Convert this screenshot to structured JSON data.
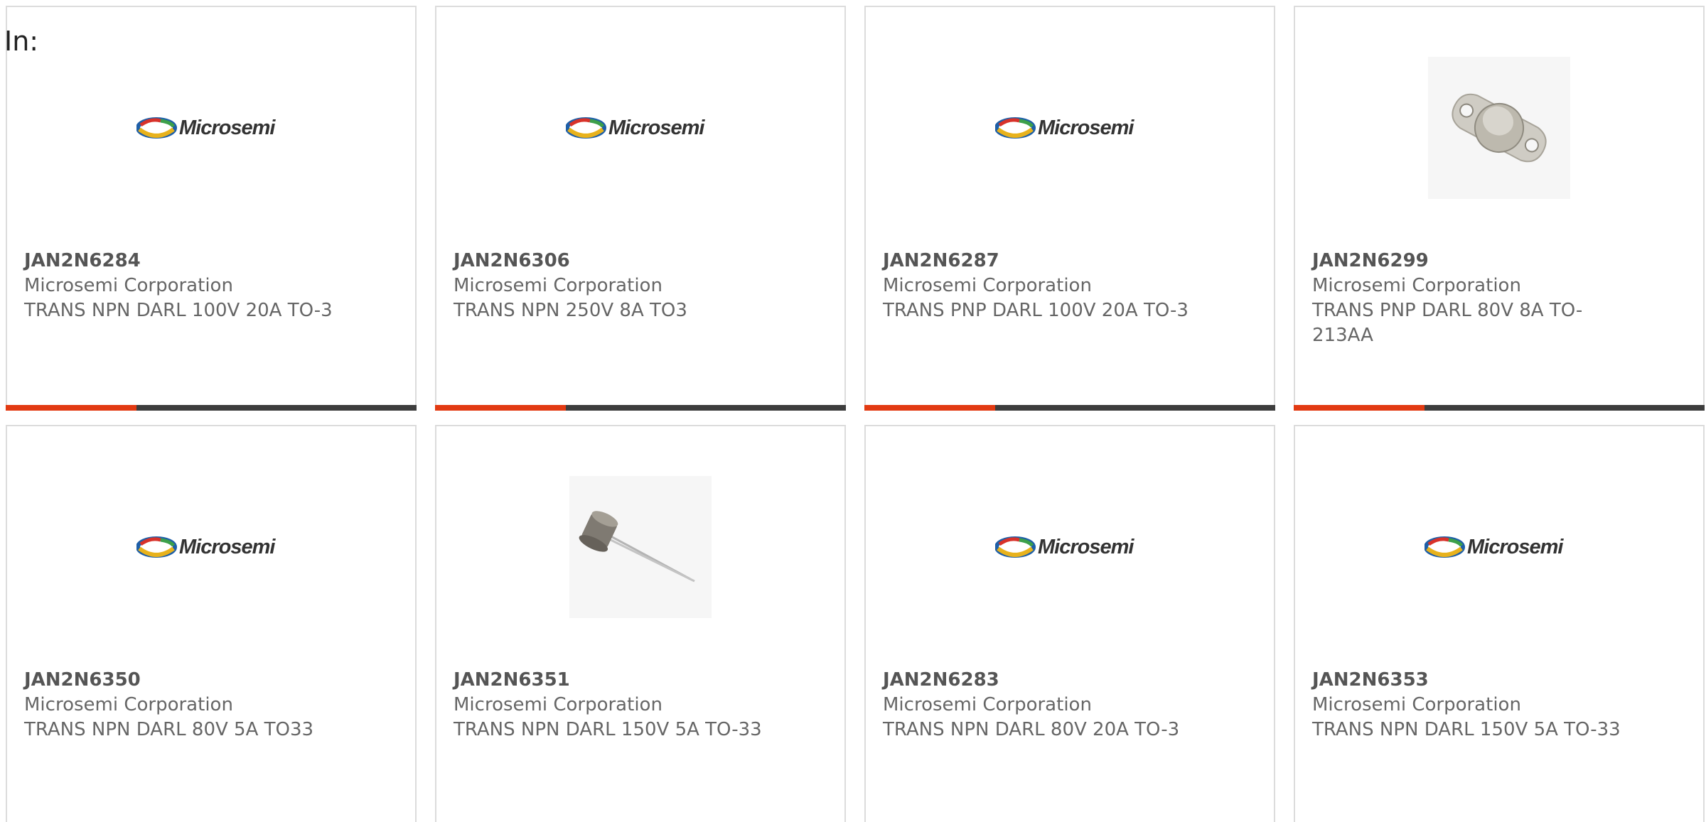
{
  "filter": {
    "label": "In:"
  },
  "products": [
    {
      "part_number": "JAN2N6284",
      "manufacturer": "Microsemi Corporation",
      "description": "TRANS NPN DARL 100V 20A TO-3",
      "image": "microsemi-logo"
    },
    {
      "part_number": "JAN2N6306",
      "manufacturer": "Microsemi Corporation",
      "description": "TRANS NPN 250V 8A TO3",
      "image": "microsemi-logo"
    },
    {
      "part_number": "JAN2N6287",
      "manufacturer": "Microsemi Corporation",
      "description": "TRANS PNP DARL 100V 20A TO-3",
      "image": "microsemi-logo"
    },
    {
      "part_number": "JAN2N6299",
      "manufacturer": "Microsemi Corporation",
      "description": "TRANS PNP DARL 80V 8A TO-213AA",
      "image": "to3-transistor-photo"
    },
    {
      "part_number": "JAN2N6350",
      "manufacturer": "Microsemi Corporation",
      "description": "TRANS NPN DARL 80V 5A TO33",
      "image": "microsemi-logo"
    },
    {
      "part_number": "JAN2N6351",
      "manufacturer": "Microsemi Corporation",
      "description": "TRANS NPN DARL 150V 5A TO-33",
      "image": "to39-transistor-photo"
    },
    {
      "part_number": "JAN2N6283",
      "manufacturer": "Microsemi Corporation",
      "description": "TRANS NPN DARL 80V 20A TO-3",
      "image": "microsemi-logo"
    },
    {
      "part_number": "JAN2N6353",
      "manufacturer": "Microsemi Corporation",
      "description": "TRANS NPN DARL 150V 5A TO-33",
      "image": "microsemi-logo"
    }
  ],
  "colors": {
    "accent": "#e23a12",
    "bar": "#3d3d3d",
    "border": "#dcdcdc",
    "text": "#666666"
  },
  "logo": {
    "text": "Microsemi"
  }
}
